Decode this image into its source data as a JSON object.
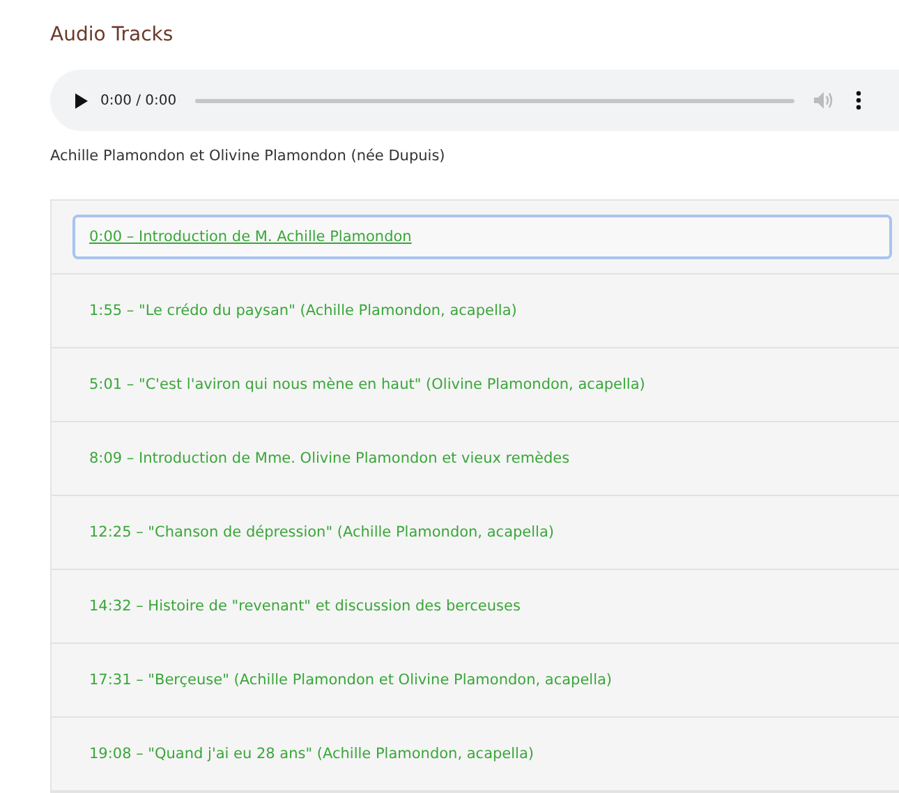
{
  "heading": "Audio Tracks",
  "player": {
    "time": "0:00 / 0:00"
  },
  "caption": "Achille Plamondon et Olivine Plamondon (née Dupuis)",
  "tracks": [
    {
      "label": "0:00 – Introduction de M. Achille Plamondon",
      "selected": true
    },
    {
      "label": "1:55 – \"Le crédo du paysan\" (Achille Plamondon, acapella)",
      "selected": false
    },
    {
      "label": "5:01 – \"C'est l'aviron qui nous mène en haut\" (Olivine Plamondon, acapella)",
      "selected": false
    },
    {
      "label": "8:09 – Introduction de Mme. Olivine Plamondon et vieux remèdes",
      "selected": false
    },
    {
      "label": "12:25 – \"Chanson de dépression\" (Achille Plamondon, acapella)",
      "selected": false
    },
    {
      "label": "14:32 – Histoire de \"revenant\" et discussion des berceuses",
      "selected": false
    },
    {
      "label": "17:31 – \"Berçeuse\" (Achille Plamondon et Olivine Plamondon, acapella)",
      "selected": false
    },
    {
      "label": "19:08 – \"Quand j'ai eu 28 ans\" (Achille Plamondon, acapella)",
      "selected": false
    }
  ]
}
